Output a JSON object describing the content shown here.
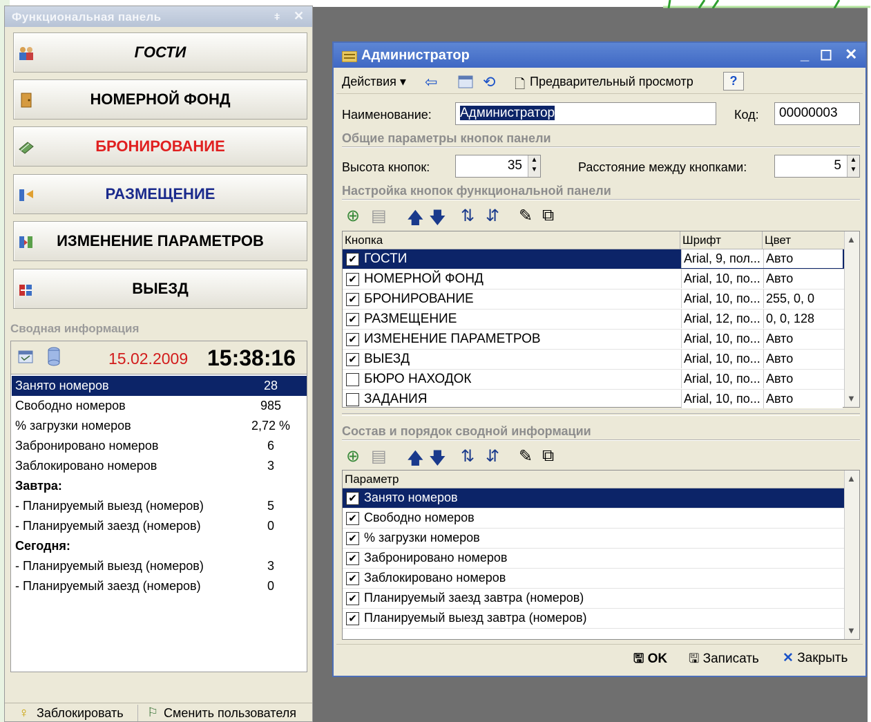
{
  "panel": {
    "title": "Функциональная панель",
    "buttons": [
      {
        "label": "ГОСТИ",
        "color": "#000000",
        "italic": true
      },
      {
        "label": "НОМЕРНОЙ ФОНД",
        "color": "#000000"
      },
      {
        "label": "БРОНИРОВАНИЕ",
        "color": "#e02020"
      },
      {
        "label": "РАЗМЕЩЕНИЕ",
        "color": "#1a2a8c"
      },
      {
        "label": "ИЗМЕНЕНИЕ ПАРАМЕТРОВ",
        "color": "#000000"
      },
      {
        "label": "ВЫЕЗД",
        "color": "#000000"
      }
    ],
    "summary_heading": "Сводная информация",
    "date": "15.02.2009",
    "time": "15:38:16",
    "summary": [
      {
        "label": "Занято номеров",
        "value": "28"
      },
      {
        "label": "Свободно номеров",
        "value": "985"
      },
      {
        "label": "% загрузки номеров",
        "value": "2,72 %"
      },
      {
        "label": "Забронировано номеров",
        "value": "6"
      },
      {
        "label": "Заблокировано номеров",
        "value": "3"
      },
      {
        "label": "Завтра:",
        "value": ""
      },
      {
        "label": "- Планируемый выезд (номеров)",
        "value": "5"
      },
      {
        "label": "- Планируемый заезд (номеров)",
        "value": "0"
      },
      {
        "label": "Сегодня:",
        "value": ""
      },
      {
        "label": "- Планируемый выезд (номеров)",
        "value": "3"
      },
      {
        "label": "- Планируемый заезд (номеров)",
        "value": "0"
      }
    ],
    "bottom": {
      "lock": "Заблокировать",
      "switch_user": "Сменить пользователя"
    }
  },
  "admin": {
    "title": "Администратор",
    "toolbar": {
      "actions": "Действия",
      "preview": "Предварительный просмотр",
      "help": "?"
    },
    "name_label": "Наименование:",
    "name_value": "Администратор",
    "code_label": "Код:",
    "code_value": "00000003",
    "group1": "Общие параметры кнопок панели",
    "height_label": "Высота кнопок:",
    "height_value": "35",
    "spacing_label": "Расстояние между кнопками:",
    "spacing_value": "5",
    "group2": "Настройка кнопок функциональной панели",
    "buttons_grid": {
      "headers": [
        "Кнопка",
        "Шрифт",
        "Цвет"
      ],
      "rows": [
        {
          "checked": true,
          "name": "ГОСТИ",
          "font": "Arial, 9, пол...",
          "color": "Авто"
        },
        {
          "checked": true,
          "name": "НОМЕРНОЙ ФОНД",
          "font": "Arial, 10, по...",
          "color": "Авто"
        },
        {
          "checked": true,
          "name": "БРОНИРОВАНИЕ",
          "font": "Arial, 10, по...",
          "color": "255, 0, 0"
        },
        {
          "checked": true,
          "name": "РАЗМЕЩЕНИЕ",
          "font": "Arial, 12, по...",
          "color": "0, 0, 128"
        },
        {
          "checked": true,
          "name": "ИЗМЕНЕНИЕ ПАРАМЕТРОВ",
          "font": "Arial, 10, по...",
          "color": "Авто"
        },
        {
          "checked": true,
          "name": "ВЫЕЗД",
          "font": "Arial, 10, по...",
          "color": "Авто"
        },
        {
          "checked": false,
          "name": "БЮРО НАХОДОК",
          "font": "Arial, 10, по...",
          "color": "Авто"
        },
        {
          "checked": false,
          "name": "ЗАДАНИЯ",
          "font": "Arial, 10, по...",
          "color": "Авто"
        }
      ]
    },
    "group3": "Состав и порядок сводной информации",
    "params_grid": {
      "header": "Параметр",
      "rows": [
        {
          "checked": true,
          "name": "Занято номеров"
        },
        {
          "checked": true,
          "name": "Свободно номеров"
        },
        {
          "checked": true,
          "name": "% загрузки номеров"
        },
        {
          "checked": true,
          "name": "Забронировано номеров"
        },
        {
          "checked": true,
          "name": "Заблокировано номеров"
        },
        {
          "checked": true,
          "name": "Планируемый заезд завтра (номеров)"
        },
        {
          "checked": true,
          "name": "Планируемый выезд завтра (номеров)"
        }
      ]
    },
    "footer": {
      "ok": "OK",
      "save": "Записать",
      "close": "Закрыть"
    }
  },
  "colors": {
    "selection": "#0c2468",
    "title_bar": "#4f78cc",
    "accent_red": "#d21c1c"
  }
}
